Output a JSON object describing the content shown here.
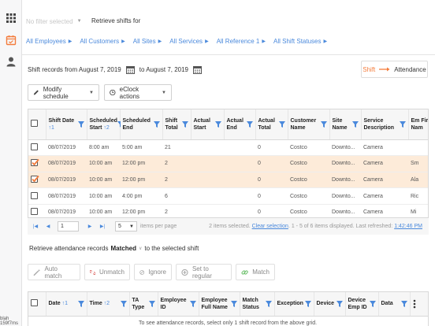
{
  "sidebar": {
    "tooltip": "blah 159f7ms"
  },
  "topbar": {
    "filter_placeholder": "No filter selected",
    "retrieve_label": "Retrieve shifts for",
    "breadcrumbs": [
      "All Employees",
      "All Customers",
      "All Sites",
      "All Services",
      "All Reference 1",
      "All Shift Statuses"
    ]
  },
  "range": {
    "from_label": "Shift records from August 7, 2019",
    "to_label": "to August 7, 2019"
  },
  "mode": {
    "left": "Shift",
    "right": "Attendance"
  },
  "toolbar": {
    "modify_label": "Modify schedule",
    "eclock_label": "eClock actions"
  },
  "shift_grid": {
    "columns": [
      {
        "label": "Shift Date",
        "sort": "↑1"
      },
      {
        "label": "Scheduled Start",
        "sort": "↑2"
      },
      {
        "label": "Scheduled End",
        "sort": ""
      },
      {
        "label": "Shift Total",
        "sort": ""
      },
      {
        "label": "Actual Start",
        "sort": ""
      },
      {
        "label": "Actual End",
        "sort": ""
      },
      {
        "label": "Actual Total",
        "sort": ""
      },
      {
        "label": "Customer Name",
        "sort": ""
      },
      {
        "label": "Site Name",
        "sort": ""
      },
      {
        "label": "Service Description",
        "sort": ""
      },
      {
        "label": "Em Firs Nam",
        "sort": ""
      }
    ],
    "rows": [
      {
        "selected": false,
        "cells": [
          "08/07/2019",
          "8:00 am",
          "5:00 am",
          "21",
          "",
          "",
          "0",
          "Costco",
          "Downto...",
          "Camera",
          ""
        ]
      },
      {
        "selected": true,
        "cells": [
          "08/07/2019",
          "10:00 am",
          "12:00 pm",
          "2",
          "",
          "",
          "0",
          "Costco",
          "Downto...",
          "Camera",
          "Sm"
        ]
      },
      {
        "selected": true,
        "cells": [
          "08/07/2019",
          "10:00 am",
          "12:00 pm",
          "2",
          "",
          "",
          "0",
          "Costco",
          "Downto...",
          "Camera",
          "Ala"
        ]
      },
      {
        "selected": false,
        "cells": [
          "08/07/2019",
          "10:00 am",
          "4:00 pm",
          "6",
          "",
          "",
          "0",
          "Costco",
          "Downto...",
          "Camera",
          "Ric"
        ]
      },
      {
        "selected": false,
        "cells": [
          "08/07/2019",
          "10:00 am",
          "12:00 pm",
          "2",
          "",
          "",
          "0",
          "Costco",
          "Downto...",
          "Camera",
          "Mi"
        ]
      }
    ]
  },
  "pager": {
    "page": "1",
    "page_size": "5",
    "per_page_label": "items per page",
    "selected_text": "2 items selected.",
    "clear_label": "Clear selection",
    "range_text": ". 1 - 5 of 6 items displayed. Last refreshed:",
    "refreshed_time": "1:42:46 PM"
  },
  "attendance": {
    "prefix": "Retrieve attendance records",
    "mode": "Matched",
    "suffix": "to the selected shift",
    "actions": [
      "Auto match",
      "Unmatch",
      "Ignore",
      "Set to regular",
      "Match"
    ],
    "columns": [
      {
        "label": "Date",
        "sort": "↑1"
      },
      {
        "label": "Time",
        "sort": "↑2"
      },
      {
        "label": "TA Type",
        "sort": ""
      },
      {
        "label": "Employee ID",
        "sort": ""
      },
      {
        "label": "Employee Full Name",
        "sort": ""
      },
      {
        "label": "Match Status",
        "sort": ""
      },
      {
        "label": "Exception",
        "sort": ""
      },
      {
        "label": "Device",
        "sort": ""
      },
      {
        "label": "Device Emp ID",
        "sort": ""
      },
      {
        "label": "Data",
        "sort": ""
      }
    ],
    "empty_note": "To see attendance records, select only 1 shift record from the above grid."
  },
  "colors": {
    "accent": "#f47c3c",
    "link": "#4a89dc",
    "selected_row": "#fdebd9"
  }
}
